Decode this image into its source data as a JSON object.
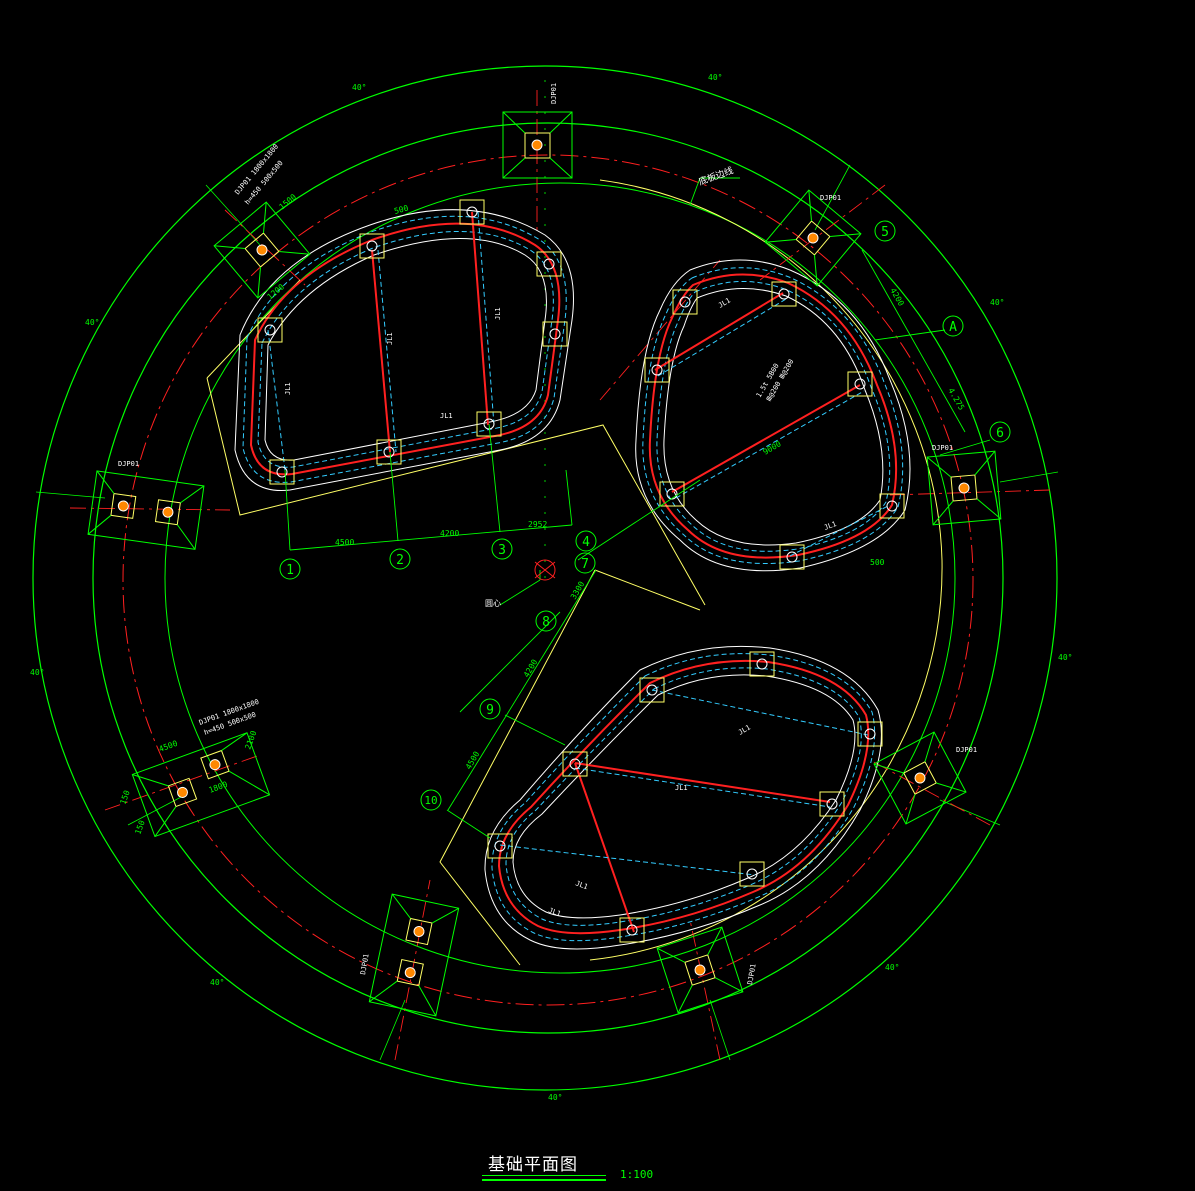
{
  "drawing": {
    "title": "基础平面图",
    "scale": "1:100",
    "note_leader_label": "底板边线",
    "center_label": "圆心",
    "colors": {
      "background": "#000000",
      "outline": "#00ff00",
      "axis": "#ff2020",
      "edge": "#ffff66",
      "wall": "#ffffff",
      "rebar": "#33ccff",
      "pile": "#ff8800"
    }
  },
  "grid_axes": [
    {
      "label": "1",
      "id": "axis-1"
    },
    {
      "label": "2",
      "id": "axis-2"
    },
    {
      "label": "3",
      "id": "axis-3"
    },
    {
      "label": "4",
      "id": "axis-4"
    },
    {
      "label": "5",
      "id": "axis-5"
    },
    {
      "label": "A",
      "id": "axis-a"
    },
    {
      "label": "6",
      "id": "axis-6"
    },
    {
      "label": "7",
      "id": "axis-7"
    },
    {
      "label": "8",
      "id": "axis-8"
    },
    {
      "label": "9",
      "id": "axis-9"
    },
    {
      "label": "10",
      "id": "axis-10"
    }
  ],
  "dimensions": {
    "axis_1_2": "4500",
    "axis_2_3": "4200",
    "axis_3_4": "2952",
    "axis_5_a": "4200",
    "axis_a_6": "4.275",
    "axis_7_8": "3300",
    "axis_8_9": "4200",
    "axis_9_10": "4500",
    "angle_40": "40°",
    "pad_1500": "1500",
    "pad_150": "150",
    "pad_4500": "4500",
    "pad_2100": "2100",
    "pad_1800": "1800",
    "pad_1200": "1200",
    "pit_9000": "9000",
    "pit_500": "500"
  },
  "notes": {
    "pad_note_line1": "DJP01 1800x1800",
    "pad_note_line2": "h=450 500x500",
    "pit_note_line1": "1.5t 5B00",
    "pit_note_line2": "Ⅲ@200 Ⅲ@200",
    "pad_code": "DJP01",
    "beam_code": "JL1"
  }
}
